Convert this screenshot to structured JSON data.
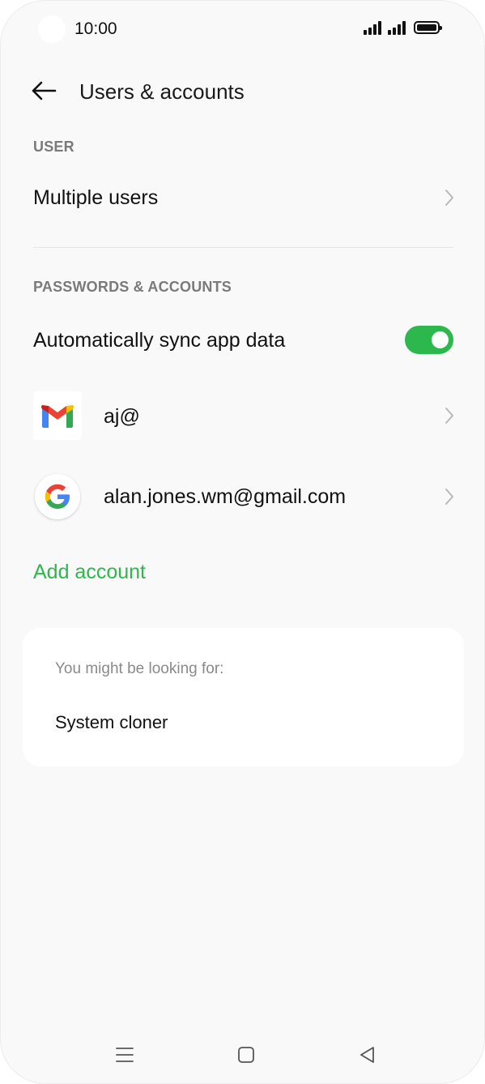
{
  "status_bar": {
    "time": "10:00"
  },
  "header": {
    "title": "Users & accounts",
    "back_icon": "arrow-left-icon"
  },
  "user_section": {
    "header": "USER",
    "items": [
      {
        "label": "Multiple users"
      }
    ]
  },
  "accounts_section": {
    "header": "PASSWORDS & ACCOUNTS",
    "sync": {
      "label": "Automatically sync app data",
      "enabled": true
    },
    "accounts": [
      {
        "label": "aj@",
        "icon": "gmail-icon"
      },
      {
        "label": "alan.jones.wm@gmail.com",
        "icon": "google-icon"
      }
    ],
    "add_account": "Add account"
  },
  "suggestions": {
    "title": "You might be looking for:",
    "items": [
      "System cloner"
    ]
  },
  "nav_bar": {
    "menu_icon": "menu-icon",
    "home_icon": "home-square-icon",
    "back_icon": "back-triangle-icon"
  },
  "colors": {
    "accent": "#2db84d",
    "background": "#f9f9f9",
    "section_header": "#7a7a7a"
  }
}
